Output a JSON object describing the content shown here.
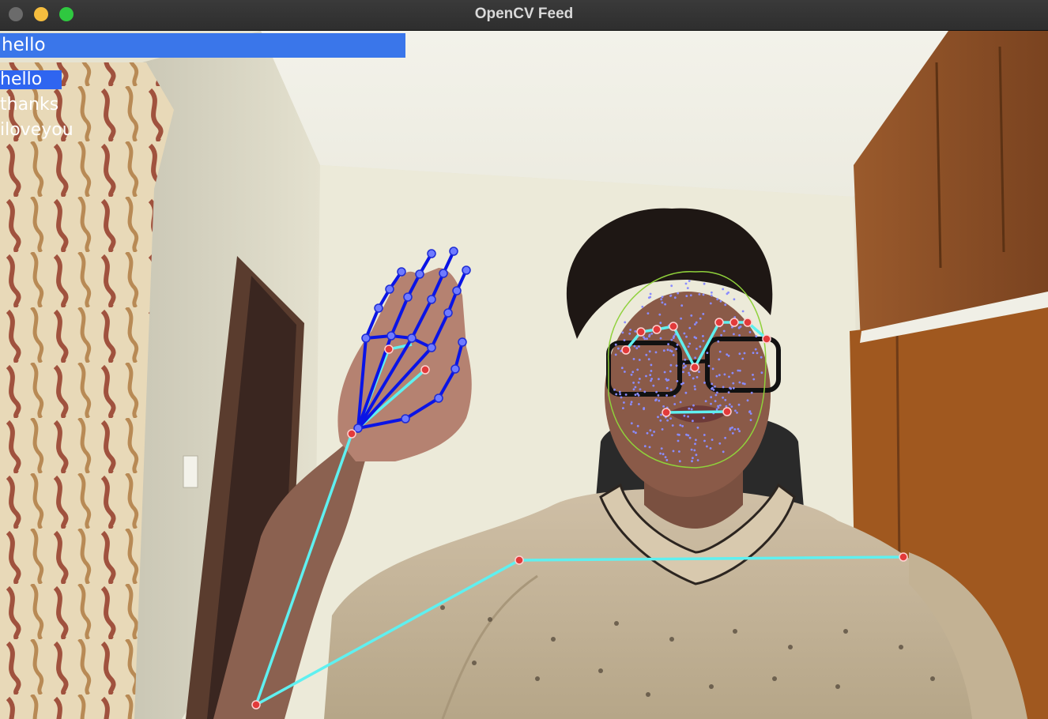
{
  "window": {
    "title": "OpenCV Feed"
  },
  "prediction": {
    "label": "hello"
  },
  "actions": [
    {
      "label": "hello",
      "selected": true
    },
    {
      "label": "thanks",
      "selected": false
    },
    {
      "label": "iloveyou",
      "selected": false
    }
  ],
  "colors": {
    "prediction_bar": "#3a76ea",
    "selected_action": "#2f65f0",
    "hand_connections": "#0a14e6",
    "hand_landmarks": "#6f7bff",
    "pose_connections": "#5ff0f0",
    "pose_landmarks": "#e23a3a",
    "face_mesh": "#8fd13b",
    "face_landmarks": "#8a8cff"
  }
}
